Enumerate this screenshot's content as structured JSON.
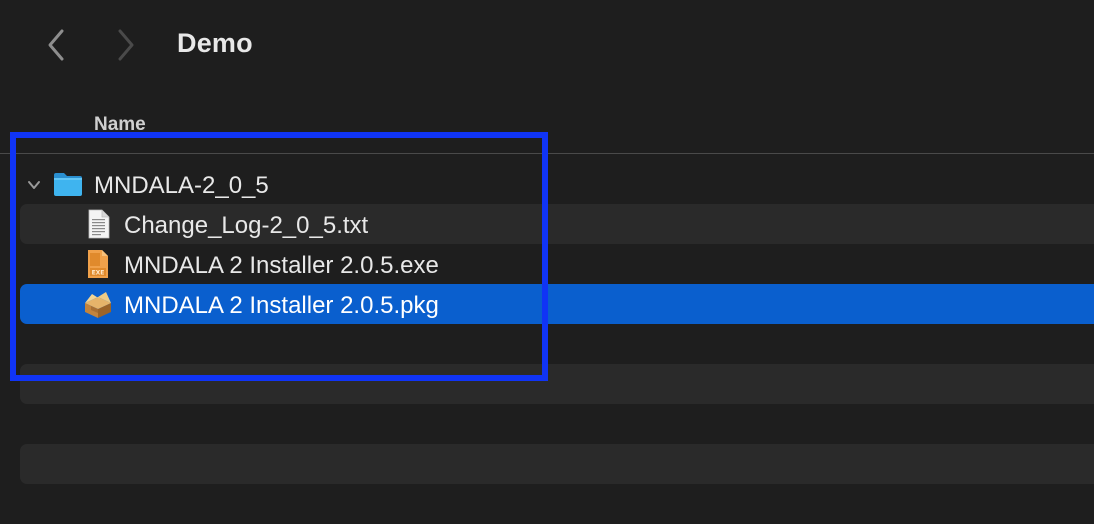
{
  "window": {
    "title": "Demo"
  },
  "columns": {
    "name": "Name"
  },
  "files": [
    {
      "name": "MNDALA-2_0_5",
      "kind": "folder-icon",
      "expanded": true,
      "level": 0,
      "selected": false
    },
    {
      "name": "Change_Log-2_0_5.txt",
      "kind": "text-document-icon",
      "level": 1,
      "selected": false
    },
    {
      "name": "MNDALA 2 Installer 2.0.5.exe",
      "kind": "exe-file-icon",
      "level": 1,
      "selected": false
    },
    {
      "name": "MNDALA 2 Installer 2.0.5.pkg",
      "kind": "installer-package-icon",
      "level": 1,
      "selected": true
    }
  ],
  "colors": {
    "background": "#1e1e1e",
    "stripe": "#2a2a2a",
    "selection": "#0a5fce",
    "annotation_box": "#1034f5",
    "folder": "#3fb4ef"
  }
}
